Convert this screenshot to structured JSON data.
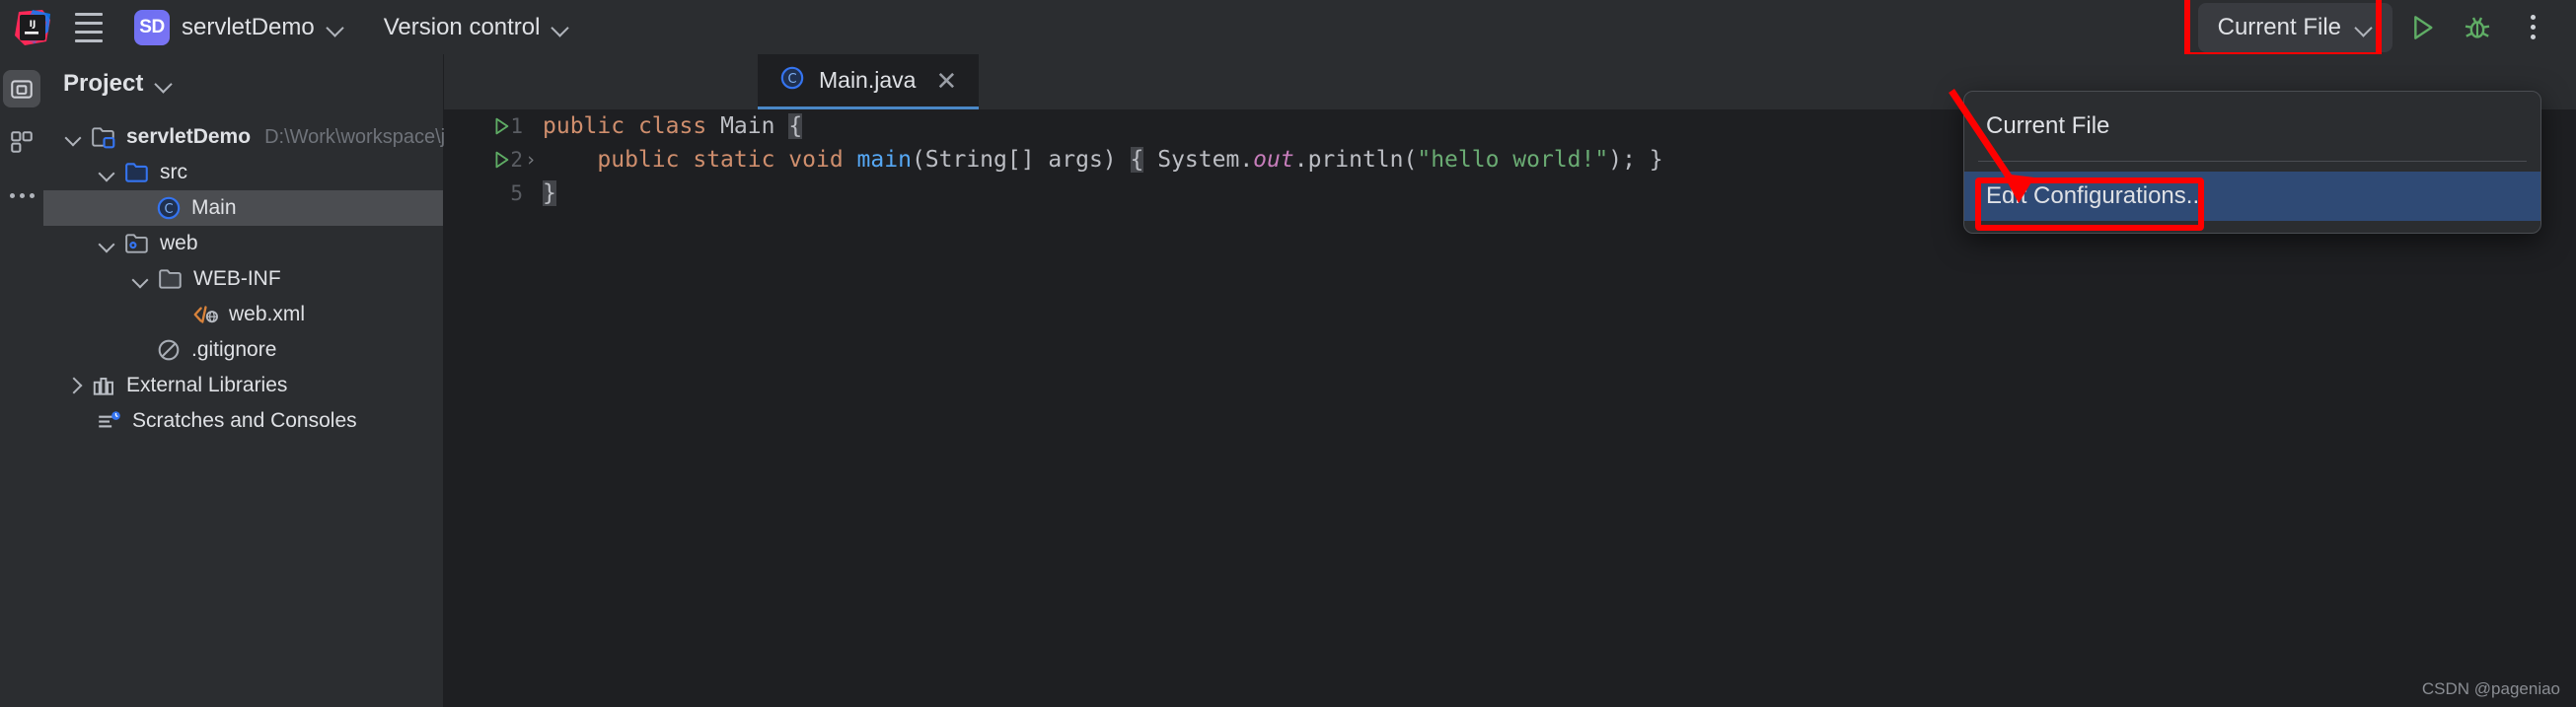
{
  "toolbar": {
    "logo_icon": "intellij-idea-logo-icon",
    "menu_icon": "hamburger-menu-icon",
    "project_badge": "SD",
    "project_name": "servletDemo",
    "vcs_label": "Version control",
    "run_config_label": "Current File",
    "run_icon": "run-play-icon",
    "debug_icon": "debug-bug-icon",
    "more_icon": "more-vertical-icon",
    "accent_red": "#fe0000"
  },
  "rail": {
    "project_icon": "project-folder-icon",
    "structure_icon": "structure-grid-icon",
    "more_icon": "more-horizontal-icon"
  },
  "project_panel": {
    "title": "Project",
    "tree": [
      {
        "label": "servletDemo",
        "path": "D:\\Work\\workspace\\javaw",
        "icon": "module-folder-icon",
        "depth": 0,
        "twist": "down",
        "selected": false
      },
      {
        "label": "src",
        "path": "",
        "icon": "source-folder-icon",
        "depth": 1,
        "twist": "down",
        "selected": false
      },
      {
        "label": "Main",
        "path": "",
        "icon": "java-class-icon",
        "depth": 2,
        "twist": "none",
        "selected": true
      },
      {
        "label": "web",
        "path": "",
        "icon": "web-folder-icon",
        "depth": 1,
        "twist": "down",
        "selected": false
      },
      {
        "label": "WEB-INF",
        "path": "",
        "icon": "folder-icon",
        "depth": 2,
        "twist": "down",
        "selected": false
      },
      {
        "label": "web.xml",
        "path": "",
        "icon": "xml-file-icon",
        "depth": 3,
        "twist": "none",
        "selected": false
      },
      {
        "label": ".gitignore",
        "path": "",
        "icon": "gitignore-icon",
        "depth": 1,
        "twist": "none",
        "selected": false
      },
      {
        "label": "External Libraries",
        "path": "",
        "icon": "libraries-icon",
        "depth": 0,
        "twist": "right",
        "selected": false
      },
      {
        "label": "Scratches and Consoles",
        "path": "",
        "icon": "scratches-icon",
        "depth": 0,
        "twist": "none",
        "selected": false
      }
    ]
  },
  "editor": {
    "tab": {
      "name": "Main.java",
      "icon": "java-class-icon",
      "close_icon": "close-icon"
    },
    "lines": [
      {
        "number": "1",
        "run_marker": true,
        "fold_marker": false
      },
      {
        "number": "2",
        "run_marker": true,
        "fold_marker": true
      },
      {
        "number": "5",
        "run_marker": false,
        "fold_marker": false
      }
    ],
    "code": {
      "l1_kw1": "public",
      "l1_kw2": "class",
      "l1_name": "Main",
      "l1_brace": "{",
      "l2_kw1": "public",
      "l2_kw2": "static",
      "l2_kw3": "void",
      "l2_fn": "main",
      "l2_params": "(String[] args)",
      "l2_brace": "{",
      "l2_system": "System.",
      "l2_out": "out",
      "l2_println": ".println(",
      "l2_string": "\"hello world!\"",
      "l2_tail": "); }",
      "l5_brace": "}"
    }
  },
  "popup": {
    "items": [
      {
        "label": "Current File",
        "highlighted": false
      },
      {
        "label": "Edit Configurations...",
        "highlighted": true
      }
    ]
  },
  "watermark": "CSDN @pageniao"
}
